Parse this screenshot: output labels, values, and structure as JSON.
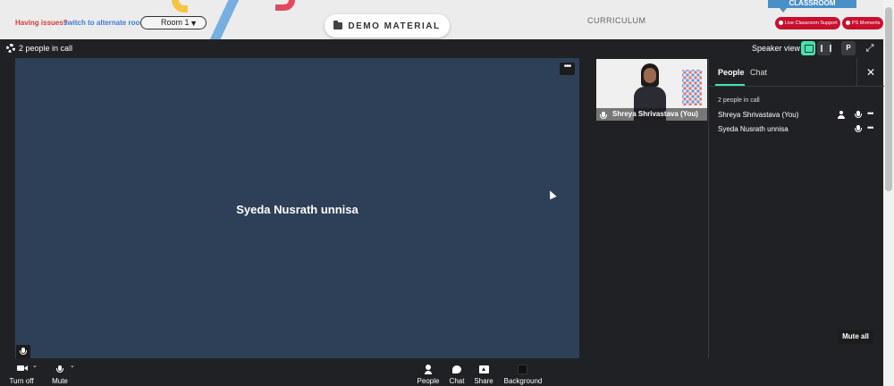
{
  "topbar": {
    "issues_label": "Having issues?",
    "alt_link": "switch to alternate room",
    "room_select": "Room 1",
    "demo_button": "DEMO MATERIAL",
    "curriculum": "CURRICULUM",
    "classroom_tab": "CLASSROOM",
    "live_support": "Live Classroom Support",
    "ps_moments": "PS Moments"
  },
  "call": {
    "people_count": "2 people in call",
    "speaker_view": "Speaker view",
    "p_button": "P"
  },
  "main_stage": {
    "speaker_name": "Syeda Nusrath unnisa"
  },
  "self_tile": {
    "name": "Shreya Shrivastava (You)"
  },
  "side_panel": {
    "tab_people": "People",
    "tab_chat": "Chat",
    "count": "2 people in call",
    "participants": [
      {
        "name": "Shreya Shrivastava (You)"
      },
      {
        "name": "Syeda Nusrath unnisa"
      }
    ],
    "mute_all": "Mute all"
  },
  "bottom_bar": {
    "camera": "Turn off",
    "mute": "Mute",
    "people": "People",
    "chat": "Chat",
    "share": "Share",
    "background": "Background"
  },
  "icons": {
    "folder": "folder-icon",
    "gear": "gear-icon",
    "close": "close-icon",
    "mic": "mic-icon"
  },
  "colors": {
    "accent": "#4be0b0",
    "stage": "#2e4057",
    "brand_red": "#c8102e",
    "link_blue": "#3d7bd6"
  }
}
